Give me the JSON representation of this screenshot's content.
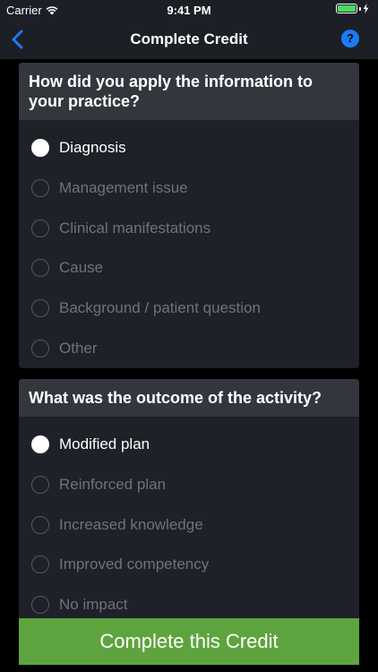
{
  "status_bar": {
    "carrier": "Carrier",
    "time": "9:41 PM"
  },
  "nav": {
    "title": "Complete Credit",
    "help_icon": "?"
  },
  "questions": [
    {
      "prompt": "How did you apply the information to your practice?",
      "options": [
        {
          "label": "Diagnosis",
          "selected": true
        },
        {
          "label": "Management issue",
          "selected": false
        },
        {
          "label": "Clinical manifestations",
          "selected": false
        },
        {
          "label": "Cause",
          "selected": false
        },
        {
          "label": "Background / patient question",
          "selected": false
        },
        {
          "label": "Other",
          "selected": false
        }
      ]
    },
    {
      "prompt": "What was the outcome of the activity?",
      "options": [
        {
          "label": "Modified plan",
          "selected": true
        },
        {
          "label": "Reinforced plan",
          "selected": false
        },
        {
          "label": "Increased knowledge",
          "selected": false
        },
        {
          "label": "Improved competency",
          "selected": false
        },
        {
          "label": "No impact",
          "selected": false
        }
      ]
    }
  ],
  "complete_button": {
    "label": "Complete this Credit"
  },
  "colors": {
    "accent_blue": "#1a7cf4",
    "button_green": "#5ea43e",
    "card_bg": "#1e2128",
    "header_bg": "#33363d"
  }
}
